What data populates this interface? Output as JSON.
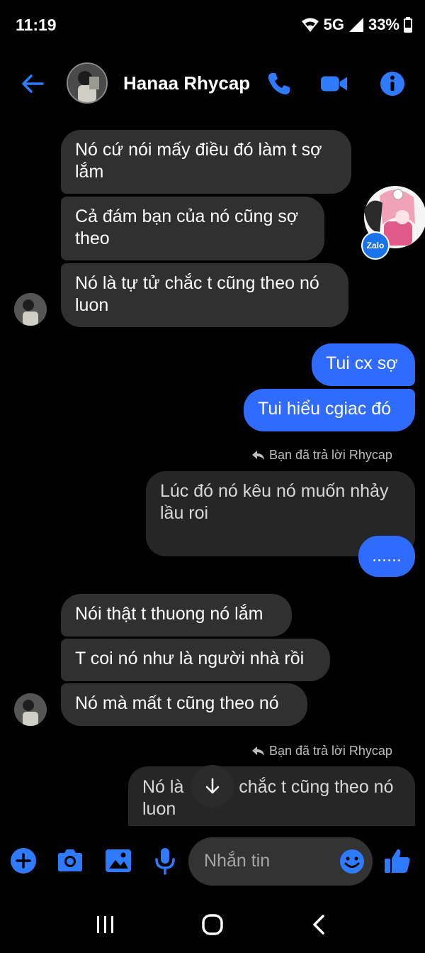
{
  "status": {
    "time": "11:19",
    "network": "5G",
    "battery": "33%"
  },
  "header": {
    "contact_name": "Hanaa Rhycap"
  },
  "messages": {
    "m1": "Nó cứ nói mấy điều đó làm t sợ lắm",
    "m2": "Cả đám bạn của nó cũng sợ theo",
    "m3": "Nó là tự tử chắc t cũng theo nó luon",
    "m4": "Tui cx sợ",
    "m5": "Tui hiểu cgiac đó",
    "reply_note_1": "Bạn đã trả lời Rhycap",
    "quoted_1": "Lúc đó nó kêu nó muốn nhảy lầu roi",
    "m6": "......",
    "m7": "Nói thật t thuong nó lắm",
    "m8": "T coi nó như là người nhà rồi",
    "m9": "Nó mà mất t cũng theo nó",
    "reply_note_2": "Bạn đã trả lời Rhycap",
    "quoted_2_a": "Nó là",
    "quoted_2_b": "chắc t cũng theo nó",
    "quoted_2_c": "luon"
  },
  "bubble_head": {
    "badge": "Zalo"
  },
  "composer": {
    "placeholder": "Nhắn tin"
  },
  "colors": {
    "accent": "#2f6bff",
    "incoming_bubble": "#303030",
    "background": "#000000"
  },
  "icons": [
    "back-arrow-icon",
    "phone-icon",
    "video-icon",
    "info-icon",
    "plus-icon",
    "camera-icon",
    "image-icon",
    "mic-icon",
    "emoji-icon",
    "thumbs-up-icon",
    "reply-icon",
    "arrow-down-icon"
  ]
}
